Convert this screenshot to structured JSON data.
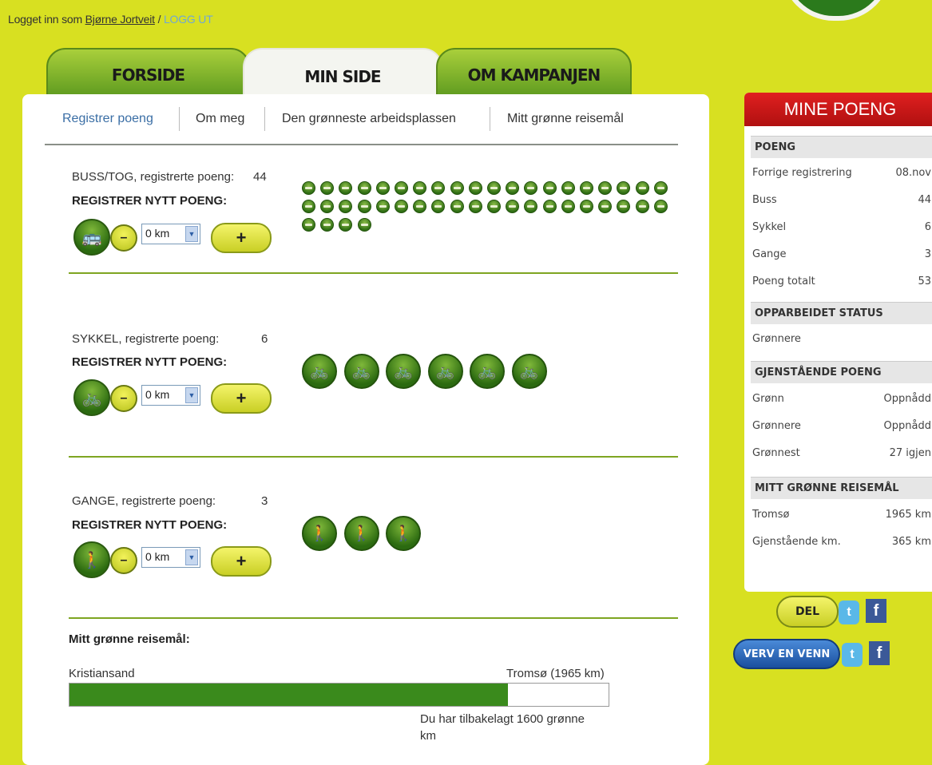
{
  "login": {
    "prefix": "Logget inn som ",
    "user": "Bjørne Jortveit",
    "sep": " / ",
    "logout": "LOGG UT"
  },
  "tabs": [
    {
      "label": "FORSIDE"
    },
    {
      "label": "MIN SIDE"
    },
    {
      "label": "OM KAMPANJEN"
    }
  ],
  "subnav": [
    {
      "label": "Registrer poeng"
    },
    {
      "label": "Om meg"
    },
    {
      "label": "Den grønneste arbeidsplassen"
    },
    {
      "label": "Mitt grønne reisemål"
    }
  ],
  "sections": [
    {
      "label": "BUSS/TOG, registrerte poeng:",
      "points": "44",
      "count": 44,
      "register": "REGISTRER NYTT POENG:",
      "select": "0 km",
      "icon": "bus-icon"
    },
    {
      "label": "SYKKEL, registrerte poeng:",
      "points": "6",
      "count": 6,
      "register": "REGISTRER NYTT POENG:",
      "select": "0 km",
      "icon": "bicycle-icon"
    },
    {
      "label": "GANGE, registrerte poeng:",
      "points": "3",
      "count": 3,
      "register": "REGISTRER NYTT POENG:",
      "select": "0 km",
      "icon": "walk-icon"
    }
  ],
  "destination": {
    "title": "Mitt grønne reisemål:",
    "start": "Kristiansand",
    "end": "Tromsø (1965 km)",
    "progress": 0.814,
    "note": "Du har tilbakelagt 1600 grønne km"
  },
  "sidebar": {
    "title": "MINE POENG",
    "poeng_title": "POENG",
    "poeng": [
      {
        "k": "Forrige registrering",
        "v": "08.nov"
      },
      {
        "k": "Buss",
        "v": "44"
      },
      {
        "k": "Sykkel",
        "v": "6"
      },
      {
        "k": "Gange",
        "v": "3"
      },
      {
        "k": "Poeng totalt",
        "v": "53"
      }
    ],
    "status_title": "OPPARBEIDET STATUS",
    "status": "Grønnere",
    "remaining_title": "GJENSTÅENDE POENG",
    "remaining": [
      {
        "k": "Grønn",
        "v": "Oppnådd"
      },
      {
        "k": "Grønnere",
        "v": "Oppnådd"
      },
      {
        "k": "Grønnest",
        "v": "27 igjen"
      }
    ],
    "dest_title": "MITT GRØNNE REISEMÅL",
    "dest": [
      {
        "k": "Tromsø",
        "v": "1965 km"
      },
      {
        "k": "Gjenstående km.",
        "v": "365 km"
      }
    ]
  },
  "share": {
    "del": "DEL",
    "verv": "VERV EN VENN"
  },
  "colors": {
    "accent": "#d8e021",
    "green": "#3a8a1c",
    "red": "#c81818"
  }
}
